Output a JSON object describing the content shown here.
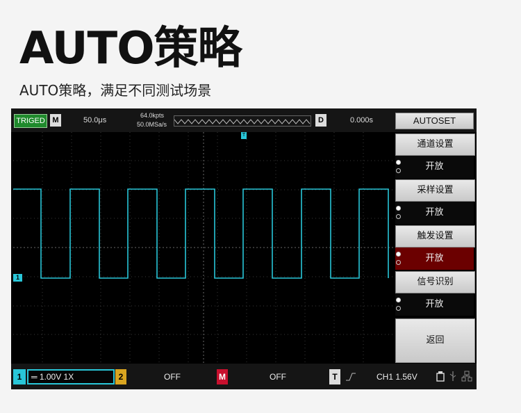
{
  "hero": {
    "title": "AUTO策略",
    "subtitle": "AUTO策略，满足不同测试场景"
  },
  "topbar": {
    "trig_status": "TRIGED",
    "mode_icon": "M",
    "timebase": "50.0μs",
    "memory_depth": "64.0kpts",
    "sample_rate": "50.0MSa/s",
    "delay_icon": "D",
    "delay": "0.000s",
    "autoset": "AUTOSET"
  },
  "menu": {
    "items": [
      {
        "label": "通道设置",
        "value": "开放"
      },
      {
        "label": "采样设置",
        "value": "开放"
      },
      {
        "label": "触发设置",
        "value": "开放",
        "active": true
      },
      {
        "label": "信号识别",
        "value": "开放"
      }
    ],
    "back": "返回"
  },
  "bottombar": {
    "ch1_num": "1",
    "ch1_setting": "═ 1.00V  1X",
    "ch2_num": "2",
    "ch2_setting": "OFF",
    "math_icon": "M",
    "math_setting": "OFF",
    "trig_icon": "T",
    "trig_setting": "CH1  1.56V"
  },
  "markers": {
    "ch1": "1",
    "trigger_pos": "T"
  },
  "colors": {
    "ch1": "#29c6d8",
    "trig_green": "#1f8a2c",
    "active_menu": "#6b0000",
    "ch2": "#d9a520",
    "math": "#c8102e"
  }
}
